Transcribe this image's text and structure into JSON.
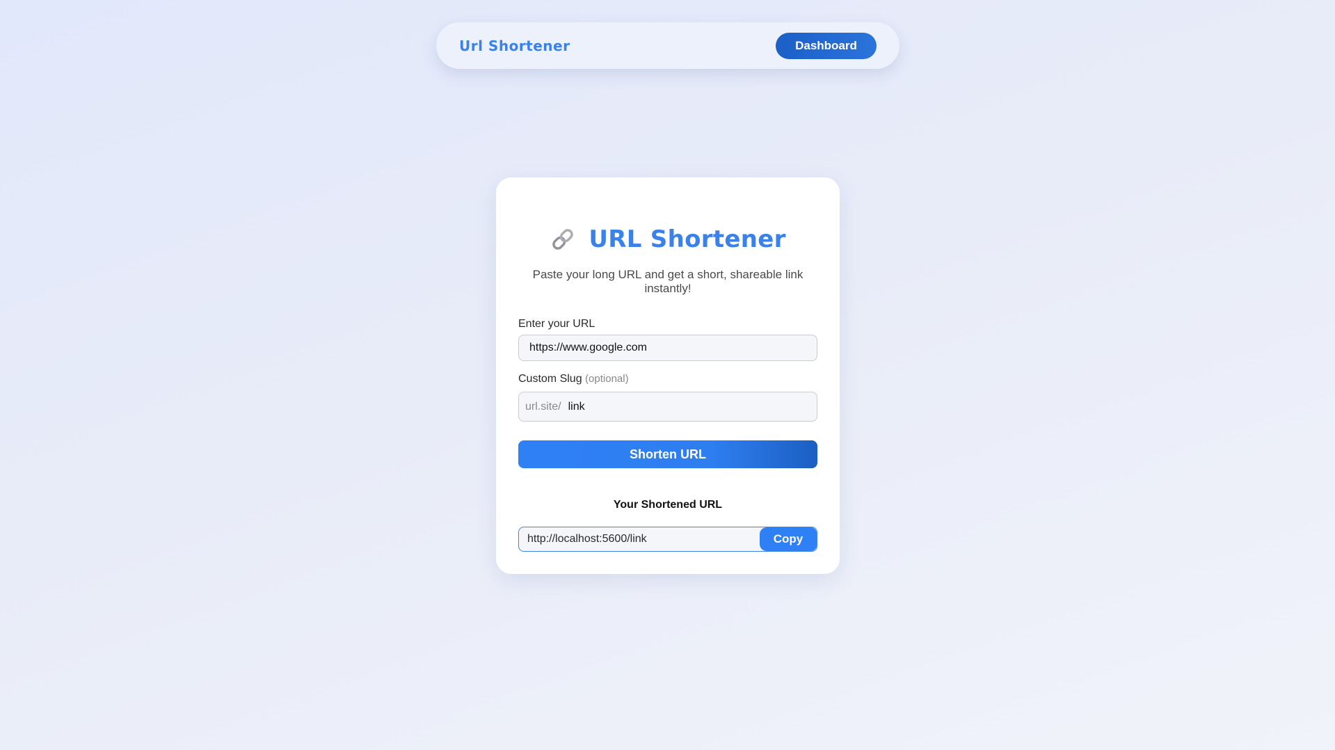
{
  "navbar": {
    "brand": "Url Shortener",
    "dashboard_label": "Dashboard"
  },
  "card": {
    "icon": "link-icon",
    "title": "URL Shortener",
    "subtitle": "Paste your long URL and get a short, shareable link instantly!",
    "url_label": "Enter your URL",
    "url_value": "https://www.google.com",
    "slug_label": "Custom Slug",
    "slug_optional": "(optional)",
    "slug_prefix": "url.site/",
    "slug_value": "link",
    "shorten_label": "Shorten URL",
    "result_heading": "Your Shortened URL",
    "result_value": "http://localhost:5600/link",
    "copy_label": "Copy"
  },
  "colors": {
    "accent": "#3a82ea",
    "button": "#2f80f5",
    "button_dark": "#1b5fc7"
  }
}
